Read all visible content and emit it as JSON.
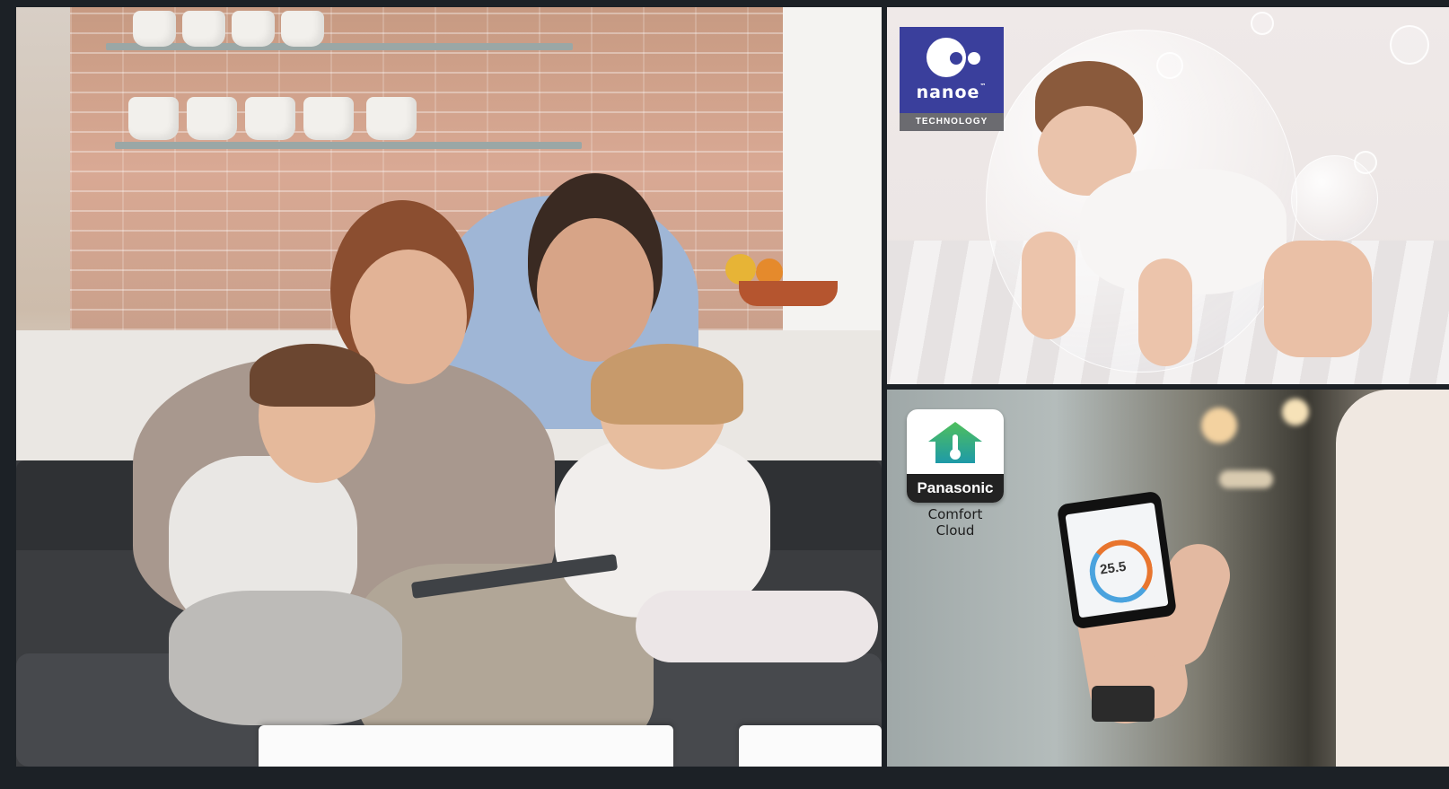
{
  "family_photo": {
    "alt": ""
  },
  "nanoe_panel": {
    "logo_word": "nanoe",
    "logo_trademark": "™",
    "logo_subtitle": "TECHNOLOGY",
    "brand_color": "#3a3f9c"
  },
  "comfort_cloud_panel": {
    "logo_brand": "Panasonic",
    "logo_caption": "Comfort Cloud",
    "phone_temperature": "25.5"
  }
}
